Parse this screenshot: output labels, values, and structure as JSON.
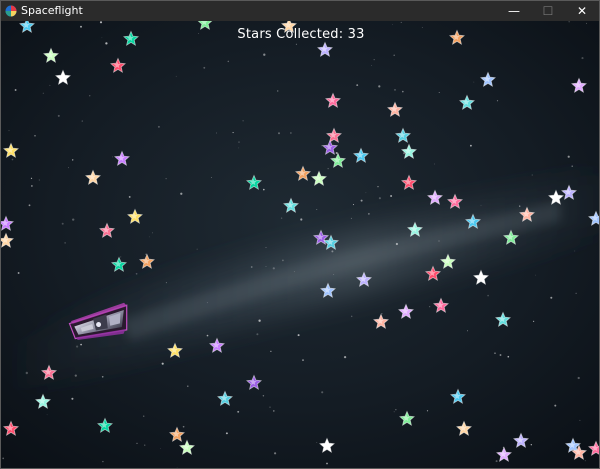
{
  "window": {
    "title": "Spaceflight",
    "controls": {
      "minimize": "—",
      "maximize": "☐",
      "close": "✕"
    }
  },
  "hud": {
    "stars_collected_label": "Stars Collected: 33"
  },
  "game": {
    "player": "spaceship",
    "collectibles": "stars",
    "star_colors": [
      "#ff6b9d",
      "#ffe066",
      "#9b5de5",
      "#4cc9f0",
      "#06d6a0",
      "#ff4d6d",
      "#a0c4ff",
      "#ffb4a2",
      "#c77dff",
      "#56cfe1",
      "#80ed99",
      "#f4a261",
      "#ffffff",
      "#e0aaff",
      "#64dfdf",
      "#fb6f92",
      "#98f5e1",
      "#ffd6a5",
      "#caffbf",
      "#bdb2ff"
    ]
  }
}
